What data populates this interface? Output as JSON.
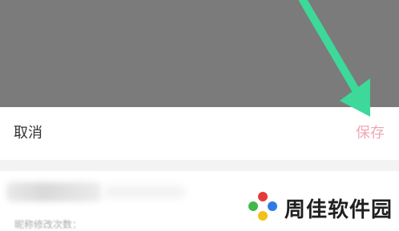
{
  "action_bar": {
    "cancel_label": "取消",
    "save_label": "保存"
  },
  "content": {
    "hint_text": "昵称修改次数："
  },
  "watermark": {
    "text": "周佳软件园"
  },
  "colors": {
    "overlay": "#7b7b7b",
    "save": "#f0a7b4",
    "arrow": "#3cd99a"
  }
}
